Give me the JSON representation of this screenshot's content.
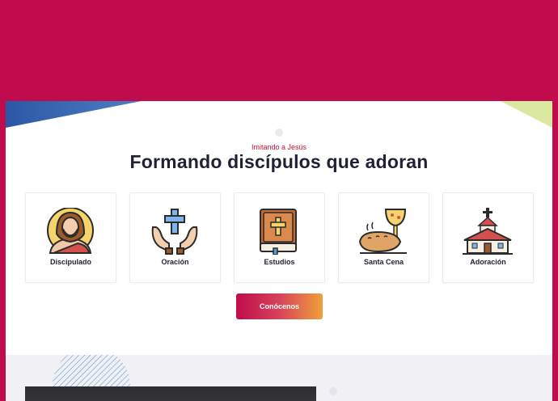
{
  "section": {
    "kicker": "Imitando a Jesús",
    "headline": "Formando discípulos que adoran"
  },
  "cards": [
    {
      "label": "Discipulado",
      "icon": "jesus-icon"
    },
    {
      "label": "Oración",
      "icon": "praying-hands-cross-icon"
    },
    {
      "label": "Estudios",
      "icon": "bible-icon"
    },
    {
      "label": "Santa Cena",
      "icon": "bread-and-chalice-icon"
    },
    {
      "label": "Adoración",
      "icon": "church-icon"
    }
  ],
  "cta": {
    "label": "Conócenos"
  },
  "colors": {
    "brand": "#c00c4c",
    "heading": "#1f2235",
    "kicker": "#c8102e",
    "accent_blue": "#2f5fa8",
    "accent_green": "#d9e9a0"
  }
}
